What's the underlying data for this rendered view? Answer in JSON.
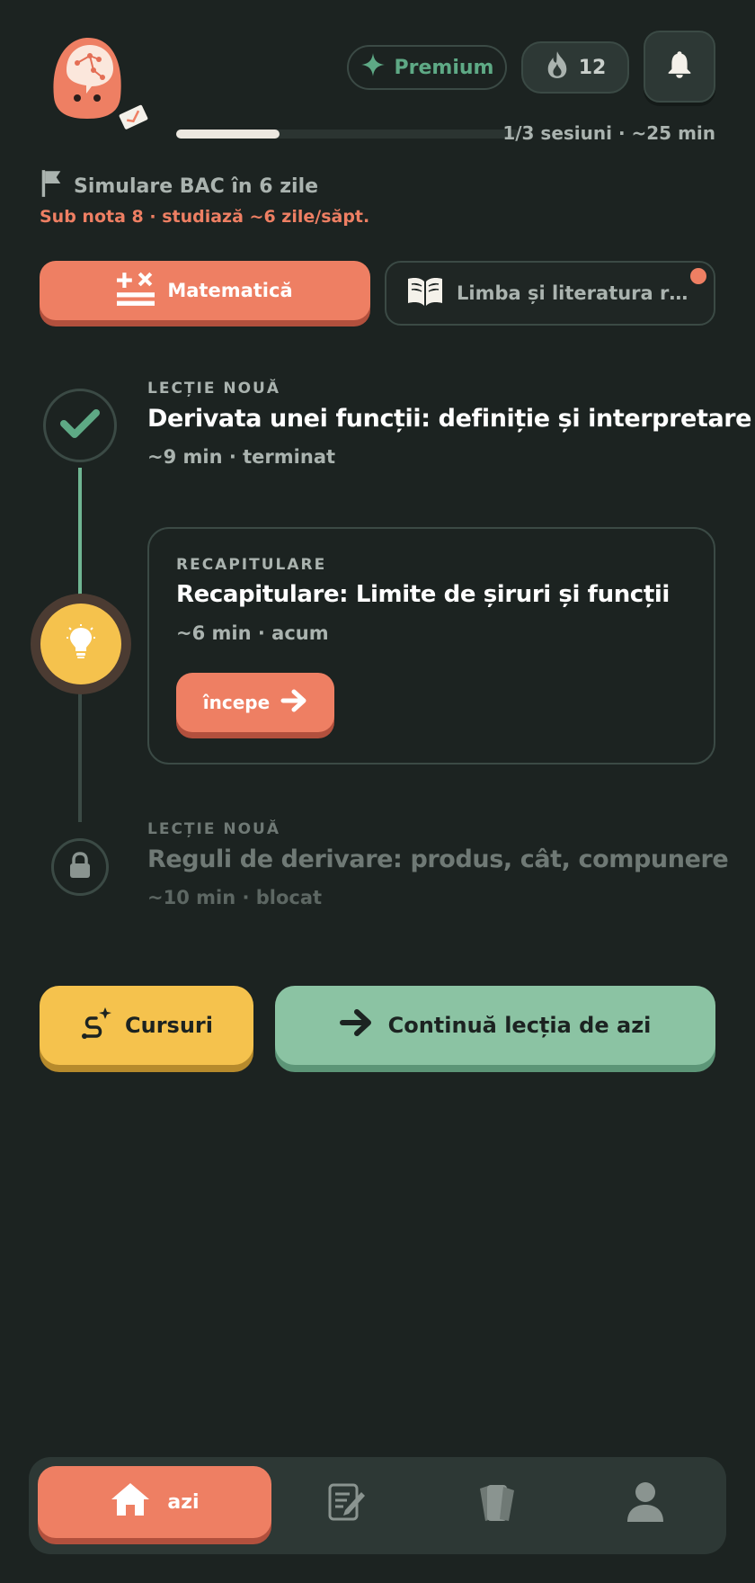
{
  "header": {
    "premium_label": "Premium",
    "streak_count": "12",
    "progress_fraction": 0.3,
    "progress_text": "1/3 sesiuni · ~25 min"
  },
  "exam": {
    "label": "Simulare BAC în 6 zile",
    "advice": "Sub nota 8 · studiază ~6 zile/săpt."
  },
  "subjects": [
    {
      "label": "Matematică",
      "active": true
    },
    {
      "label": "Limba și literatura română",
      "active": false,
      "has_notification": true
    }
  ],
  "lessons": [
    {
      "kicker": "LECȚIE NOUĂ",
      "title": "Derivata unei funcții: definiție și interpretare",
      "meta": "~9 min · terminat",
      "state": "done"
    },
    {
      "kicker": "RECAPITULARE",
      "title": "Recapitulare: Limite de șiruri și funcții",
      "meta": "~6 min · acum",
      "state": "current",
      "button": "începe"
    },
    {
      "kicker": "LECȚIE NOUĂ",
      "title": "Reguli de derivare: produs, cât, compunere",
      "meta": "~10 min · blocat",
      "state": "locked"
    }
  ],
  "actions": {
    "courses_label": "Cursuri",
    "continue_label": "Continuă lecția de azi"
  },
  "nav": {
    "home_label": "azi",
    "items": [
      "home-icon",
      "notes-icon",
      "cards-icon",
      "profile-icon"
    ]
  },
  "colors": {
    "background": "#1c2321",
    "accent": "#ee7f63",
    "yellow": "#f5c24d",
    "green": "#8bc3a3"
  }
}
